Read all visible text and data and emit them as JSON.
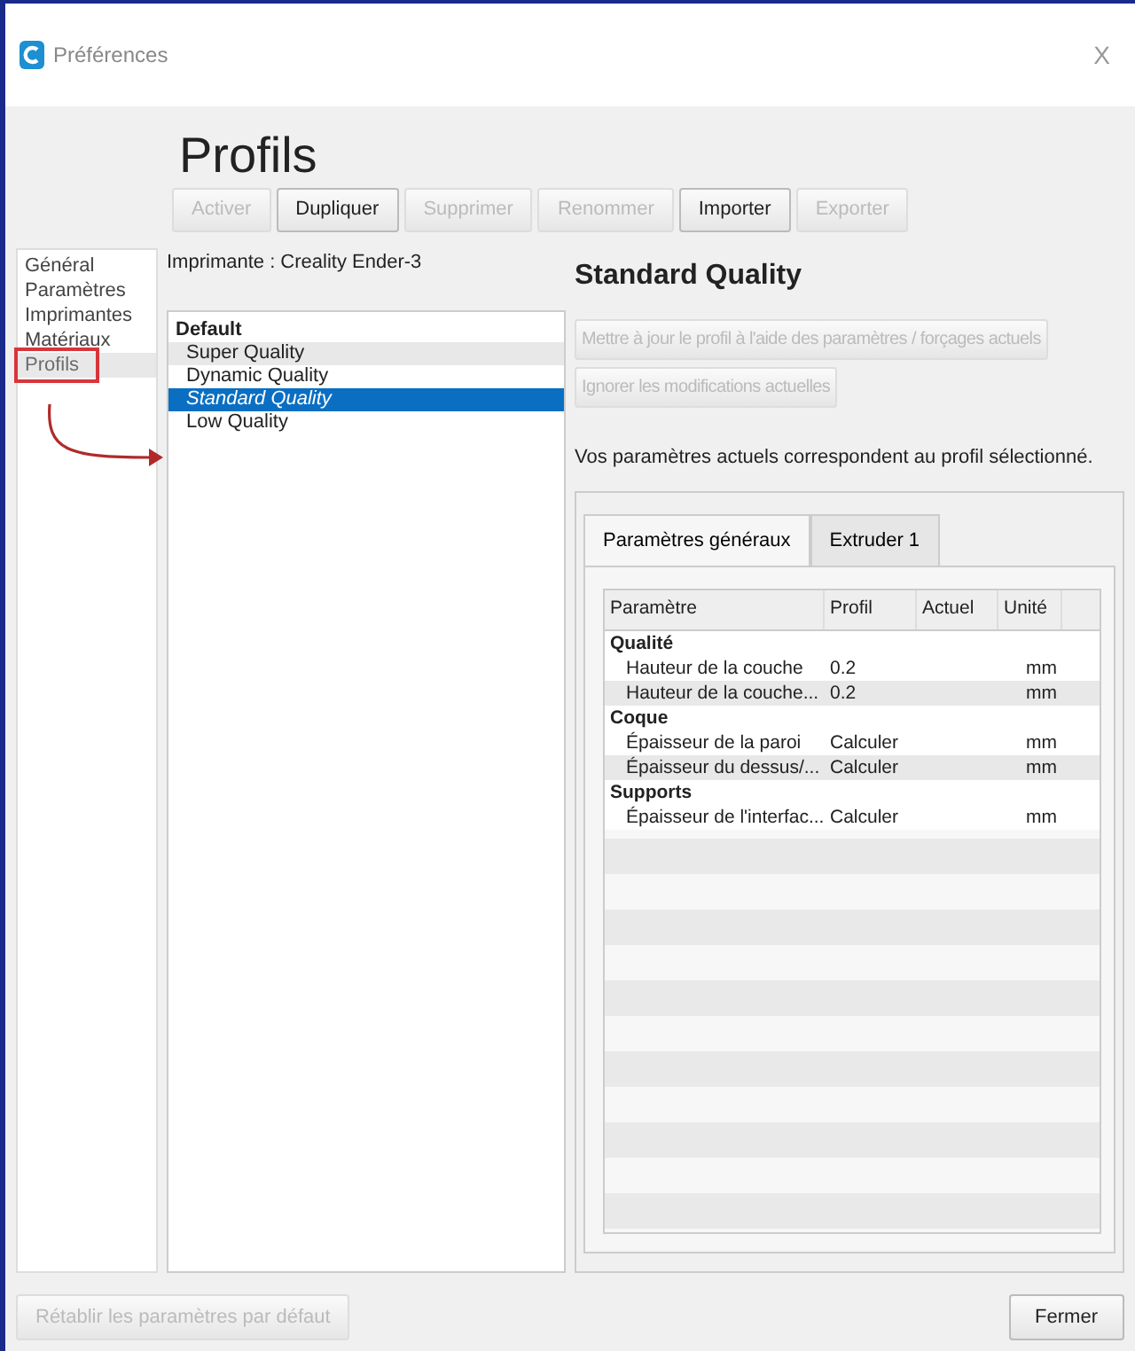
{
  "window": {
    "title": "Préférences",
    "close": "X"
  },
  "sidebar": {
    "items": [
      {
        "label": "Général",
        "selected": false
      },
      {
        "label": "Paramètres",
        "selected": false
      },
      {
        "label": "Imprimantes",
        "selected": false
      },
      {
        "label": "Matériaux",
        "selected": false
      },
      {
        "label": "Profils",
        "selected": true
      }
    ]
  },
  "heading": "Profils",
  "toolbar": [
    {
      "label": "Activer",
      "disabled": true
    },
    {
      "label": "Dupliquer",
      "disabled": false
    },
    {
      "label": "Supprimer",
      "disabled": true
    },
    {
      "label": "Renommer",
      "disabled": true
    },
    {
      "label": "Importer",
      "disabled": false
    },
    {
      "label": "Exporter",
      "disabled": true
    }
  ],
  "printer": "Imprimante : Creality Ender-3",
  "profiles": [
    {
      "label": "Default",
      "kind": "group",
      "selected": false
    },
    {
      "label": "Super Quality",
      "kind": "item",
      "selected": false
    },
    {
      "label": "Dynamic Quality",
      "kind": "item",
      "selected": false
    },
    {
      "label": "Standard Quality",
      "kind": "item",
      "selected": true
    },
    {
      "label": "Low Quality",
      "kind": "item",
      "selected": false
    }
  ],
  "detail": {
    "title": "Standard Quality",
    "actions": [
      {
        "label": "Mettre à jour le profil à l'aide des paramètres / forçages actuels",
        "disabled": true
      },
      {
        "label": "Ignorer les modifications actuelles",
        "disabled": true
      }
    ],
    "message": "Vos paramètres actuels correspondent au profil sélectionné.",
    "tabs": [
      {
        "label": "Paramètres généraux",
        "selected": true
      },
      {
        "label": "Extruder 1",
        "selected": false
      }
    ],
    "table": {
      "columns": [
        "Paramètre",
        "Profil",
        "Actuel",
        "Unité"
      ],
      "rows": [
        {
          "kind": "group",
          "label": "Qualité"
        },
        {
          "kind": "setting",
          "label": "Hauteur de la couche",
          "profile": "0.2",
          "unit": "mm"
        },
        {
          "kind": "setting",
          "label": "Hauteur de la couche...",
          "profile": "0.2",
          "unit": "mm"
        },
        {
          "kind": "group",
          "label": "Coque"
        },
        {
          "kind": "setting",
          "label": "Épaisseur de la paroi",
          "profile": "Calculer",
          "unit": "mm"
        },
        {
          "kind": "setting",
          "label": "Épaisseur du dessus/...",
          "profile": "Calculer",
          "unit": "mm"
        },
        {
          "kind": "group",
          "label": "Supports"
        },
        {
          "kind": "setting",
          "label": "Épaisseur de l'interfac...",
          "profile": "Calculer",
          "unit": "mm"
        }
      ]
    }
  },
  "footer": [
    {
      "label": "Rétablir les paramètres par défaut",
      "disabled": true
    },
    {
      "label": "Fermer",
      "disabled": false
    }
  ]
}
